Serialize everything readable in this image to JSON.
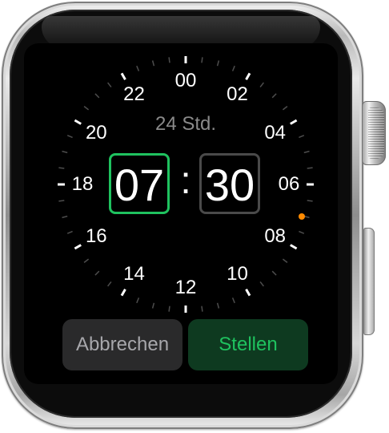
{
  "time_picker": {
    "format_label": "24 Std.",
    "hours_value": "07",
    "separator": ":",
    "minutes_value": "30",
    "dial_numbers": [
      "00",
      "02",
      "04",
      "06",
      "08",
      "10",
      "12",
      "14",
      "16",
      "18",
      "20",
      "22"
    ],
    "selected_field": "hours"
  },
  "actions": {
    "cancel_label": "Abbrechen",
    "set_label": "Stellen"
  },
  "colors": {
    "accent_green": "#1fc25f",
    "indicator_orange": "#ff8a00",
    "screen_background": "#000000"
  },
  "icons": {
    "digital_crown": "digital-crown",
    "side_button": "side-button"
  }
}
